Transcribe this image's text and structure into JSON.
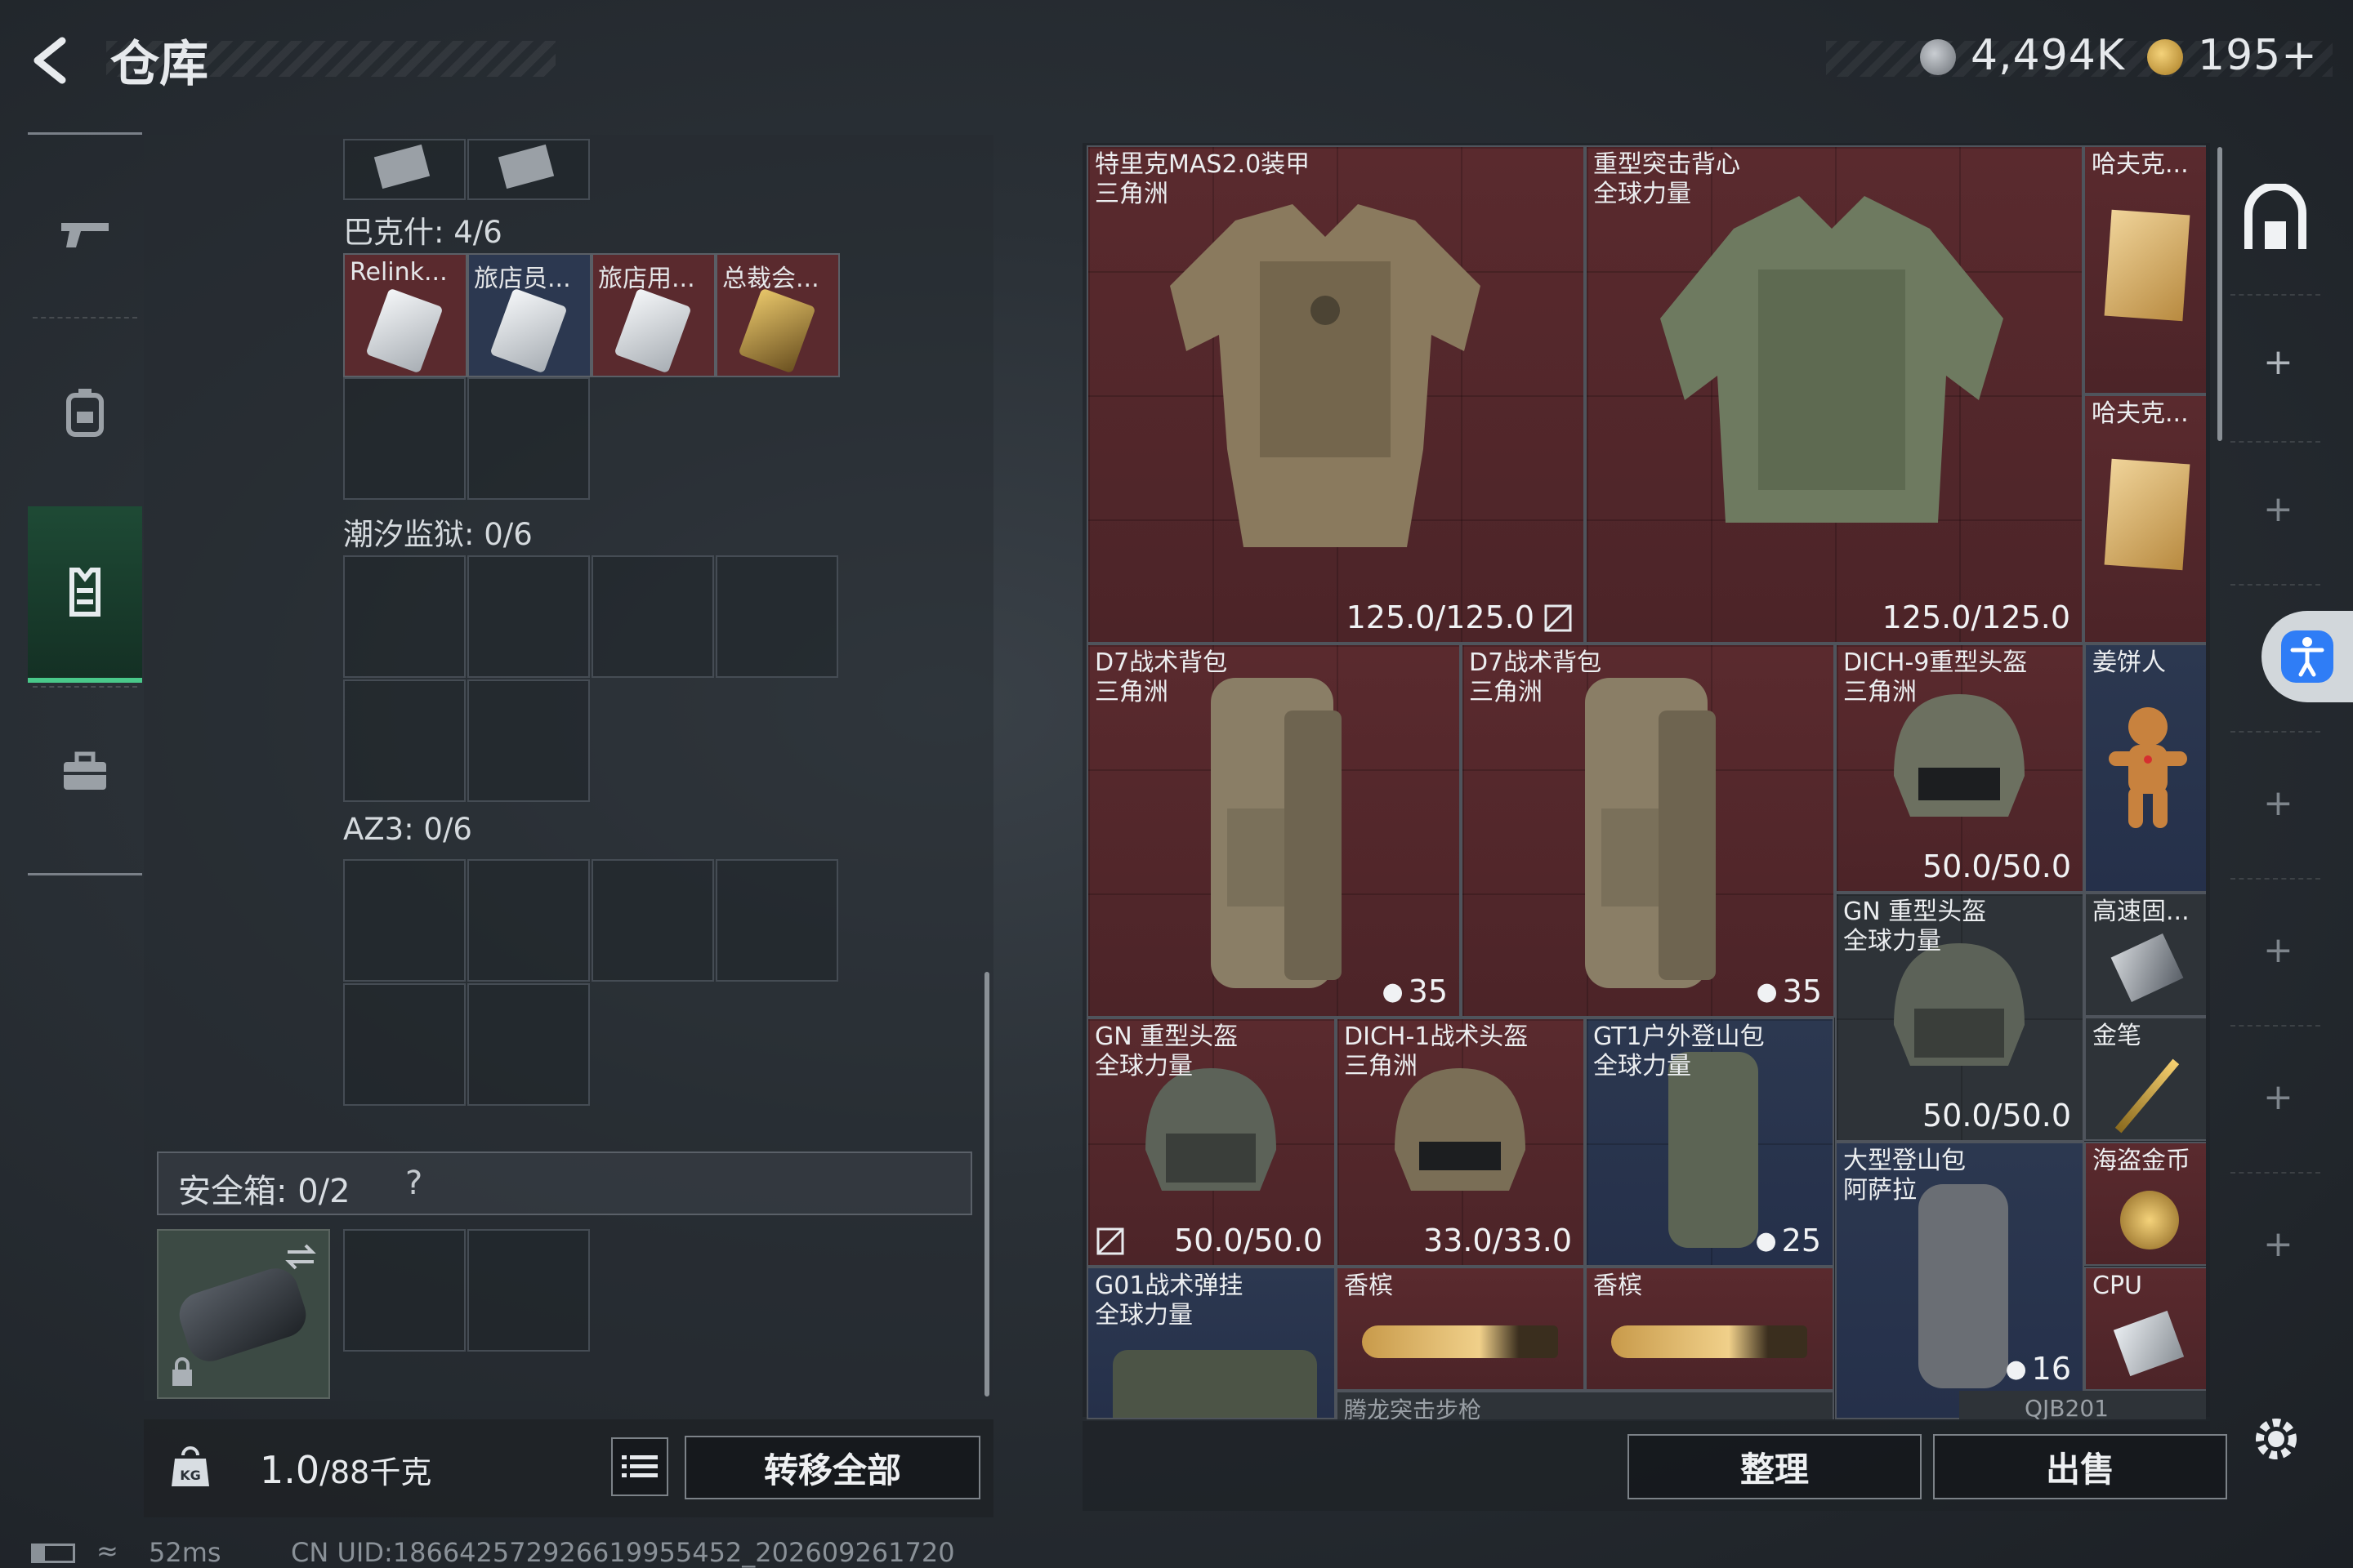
{
  "header": {
    "title": "仓库",
    "currency_1": "4,494K",
    "currency_2": "195+"
  },
  "sidebar": {
    "items": [
      {
        "name": "weapon-icon"
      },
      {
        "name": "backpack-icon"
      },
      {
        "name": "vest-icon"
      },
      {
        "name": "briefcase-icon"
      }
    ]
  },
  "left": {
    "sections": [
      {
        "label": "巴克什: 4/6"
      },
      {
        "label": "潮汐监狱: 0/6"
      },
      {
        "label": "AZ3: 0/6"
      }
    ],
    "keys": [
      {
        "label": "Relink..."
      },
      {
        "label": "旅店员..."
      },
      {
        "label": "旅店用..."
      },
      {
        "label": "总裁会..."
      }
    ],
    "safe_box": "安全箱: 0/2",
    "safe_help": "?",
    "weight": "1.0",
    "weight_max": "/88千克",
    "transfer_all": "转移全部"
  },
  "right": {
    "items": [
      {
        "id": "armor1",
        "name": "特里克MAS2.0装甲",
        "sub": "三角洲",
        "durability": "125.0/125.0"
      },
      {
        "id": "armor2",
        "name": "重型突击背心",
        "sub": "全球力量",
        "durability": "125.0/125.0"
      },
      {
        "id": "book1",
        "name": "哈夫克..."
      },
      {
        "id": "book2",
        "name": "哈夫克..."
      },
      {
        "id": "bag1",
        "name": "D7战术背包",
        "sub": "三角洲",
        "count": "35"
      },
      {
        "id": "bag2",
        "name": "D7战术背包",
        "sub": "三角洲",
        "count": "35"
      },
      {
        "id": "helm1",
        "name": "DICH-9重型头盔",
        "sub": "三角洲",
        "durability": "50.0/50.0"
      },
      {
        "id": "ginger",
        "name": "姜饼人"
      },
      {
        "id": "helm2",
        "name": "GN 重型头盔",
        "sub": "全球力量",
        "durability": "50.0/50.0"
      },
      {
        "id": "drive",
        "name": "高速固..."
      },
      {
        "id": "helm3",
        "name": "GN 重型头盔",
        "sub": "全球力量",
        "durability": "50.0/50.0"
      },
      {
        "id": "helm4",
        "name": "DICH-1战术头盔",
        "sub": "三角洲",
        "durability": "33.0/33.0"
      },
      {
        "id": "bag3",
        "name": "GT1户外登山包",
        "sub": "全球力量",
        "count": "25"
      },
      {
        "id": "pen",
        "name": "金笔"
      },
      {
        "id": "bag4",
        "name": "大型登山包",
        "sub": "阿萨拉",
        "count": "16"
      },
      {
        "id": "coin",
        "name": "海盗金币"
      },
      {
        "id": "rig",
        "name": "G01战术弹挂",
        "sub": "全球力量"
      },
      {
        "id": "champ1",
        "name": "香槟"
      },
      {
        "id": "champ2",
        "name": "香槟"
      },
      {
        "id": "cpu",
        "name": "CPU"
      },
      {
        "id": "rifle",
        "name": "腾龙突击步枪"
      },
      {
        "id": "qjb",
        "name": "QJB201"
      }
    ],
    "organize": "整理",
    "sell": "出售"
  },
  "status": {
    "ping": "52ms",
    "uid": "CN UID:18664257292661995545​2_202609261720"
  },
  "colors": {
    "red_rarity": "#5a2a2e",
    "blue_rarity": "#2c3850",
    "active_tab": "#49c98a",
    "accessibility": "#2f7df6"
  }
}
